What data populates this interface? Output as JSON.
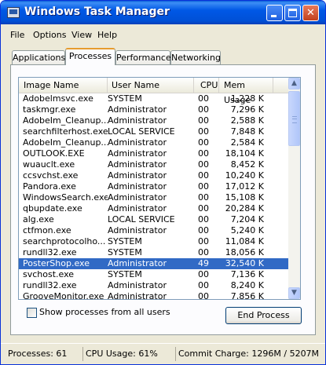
{
  "window": {
    "title": "Windows Task Manager"
  },
  "menu": [
    "File",
    "Options",
    "View",
    "Help"
  ],
  "tabs": [
    "Applications",
    "Processes",
    "Performance",
    "Networking"
  ],
  "active_tab": "Processes",
  "columns": {
    "name": "Image Name",
    "user": "User Name",
    "cpu": "CPU",
    "mem": "Mem Usage"
  },
  "processes": [
    {
      "name": "Adobelmsvc.exe",
      "user": "SYSTEM",
      "cpu": "00",
      "mem": "1,228 K"
    },
    {
      "name": "taskmgr.exe",
      "user": "Administrator",
      "cpu": "00",
      "mem": "7,296 K"
    },
    {
      "name": "AdobeIm_Cleanup...",
      "user": "Administrator",
      "cpu": "00",
      "mem": "2,588 K"
    },
    {
      "name": "searchfilterhost.exe",
      "user": "LOCAL SERVICE",
      "cpu": "00",
      "mem": "7,848 K"
    },
    {
      "name": "AdobeIm_Cleanup...",
      "user": "Administrator",
      "cpu": "00",
      "mem": "2,584 K"
    },
    {
      "name": "OUTLOOK.EXE",
      "user": "Administrator",
      "cpu": "00",
      "mem": "18,104 K"
    },
    {
      "name": "wuauclt.exe",
      "user": "Administrator",
      "cpu": "00",
      "mem": "8,452 K"
    },
    {
      "name": "ccsvchst.exe",
      "user": "Administrator",
      "cpu": "00",
      "mem": "10,240 K"
    },
    {
      "name": "Pandora.exe",
      "user": "Administrator",
      "cpu": "00",
      "mem": "17,012 K"
    },
    {
      "name": "WindowsSearch.exe",
      "user": "Administrator",
      "cpu": "00",
      "mem": "15,108 K"
    },
    {
      "name": "qbupdate.exe",
      "user": "Administrator",
      "cpu": "00",
      "mem": "20,284 K"
    },
    {
      "name": "alg.exe",
      "user": "LOCAL SERVICE",
      "cpu": "00",
      "mem": "7,204 K"
    },
    {
      "name": "ctfmon.exe",
      "user": "Administrator",
      "cpu": "00",
      "mem": "5,240 K"
    },
    {
      "name": "searchprotocolho...",
      "user": "SYSTEM",
      "cpu": "00",
      "mem": "11,084 K"
    },
    {
      "name": "rundll32.exe",
      "user": "SYSTEM",
      "cpu": "00",
      "mem": "18,056 K"
    },
    {
      "name": "PosterShop.exe",
      "user": "Administrator",
      "cpu": "49",
      "mem": "32,540 K",
      "selected": true
    },
    {
      "name": "svchost.exe",
      "user": "SYSTEM",
      "cpu": "00",
      "mem": "7,136 K"
    },
    {
      "name": "rundll32.exe",
      "user": "Administrator",
      "cpu": "00",
      "mem": "8,240 K"
    },
    {
      "name": "GrooveMonitor.exe",
      "user": "Administrator",
      "cpu": "00",
      "mem": "7,856 K"
    }
  ],
  "show_all_label": "Show processes from all users",
  "show_all_checked": false,
  "end_process_label": "End Process",
  "status": {
    "processes": "Processes: 61",
    "cpu": "CPU Usage: 61%",
    "commit": "Commit Charge: 1296M / 5207M"
  },
  "colors": {
    "titlebar": "#0058e6",
    "selection": "#316ac5",
    "tab_highlight": "#e69c2f",
    "close_button": "#c2401d"
  },
  "icons": {
    "app": "task-manager-icon",
    "min": "minimize-icon",
    "max": "maximize-icon",
    "close": "close-icon",
    "up": "arrow-up-icon",
    "down": "arrow-down-icon"
  }
}
